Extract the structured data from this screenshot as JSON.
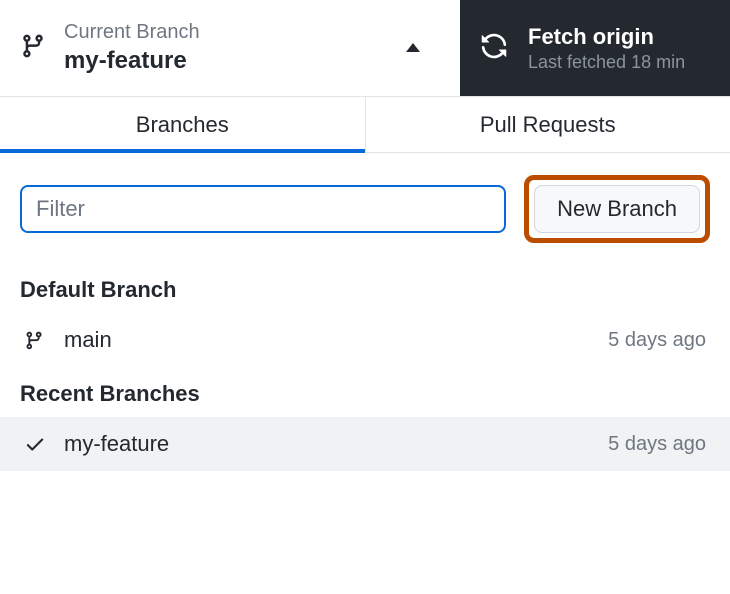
{
  "header": {
    "currentBranchLabel": "Current Branch",
    "currentBranchName": "my-feature",
    "fetchTitle": "Fetch origin",
    "fetchSubtitle": "Last fetched 18 min"
  },
  "tabs": {
    "branches": "Branches",
    "pullRequests": "Pull Requests"
  },
  "toolbar": {
    "filterPlaceholder": "Filter",
    "newBranchLabel": "New Branch"
  },
  "sections": {
    "defaultBranch": "Default Branch",
    "recentBranches": "Recent Branches"
  },
  "defaultBranch": {
    "name": "main",
    "time": "5 days ago"
  },
  "recentBranches": [
    {
      "name": "my-feature",
      "time": "5 days ago"
    }
  ]
}
